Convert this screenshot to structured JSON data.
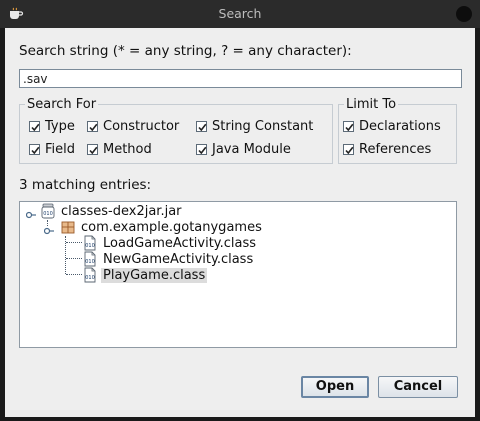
{
  "window": {
    "title": "Search"
  },
  "search": {
    "label": "Search string (* = any string, ? = any character):",
    "value": ".sav"
  },
  "search_for": {
    "legend": "Search For",
    "options": [
      {
        "label": "Type",
        "checked": true
      },
      {
        "label": "Constructor",
        "checked": true
      },
      {
        "label": "String Constant",
        "checked": true
      },
      {
        "label": "Field",
        "checked": true
      },
      {
        "label": "Method",
        "checked": true
      },
      {
        "label": "Java Module",
        "checked": true
      }
    ]
  },
  "limit_to": {
    "legend": "Limit To",
    "options": [
      {
        "label": "Declarations",
        "checked": true
      },
      {
        "label": "References",
        "checked": true
      }
    ]
  },
  "results": {
    "label": "3 matching entries:",
    "tree": [
      {
        "label": "classes-dex2jar.jar",
        "icon": "jar-icon"
      },
      {
        "label": "com.example.gotanygames",
        "icon": "package-icon"
      },
      {
        "label": "LoadGameActivity.class",
        "icon": "class-file-icon"
      },
      {
        "label": "NewGameActivity.class",
        "icon": "class-file-icon"
      },
      {
        "label": "PlayGame.class",
        "icon": "class-file-icon",
        "selected": true
      }
    ]
  },
  "buttons": {
    "open": "Open",
    "cancel": "Cancel"
  }
}
